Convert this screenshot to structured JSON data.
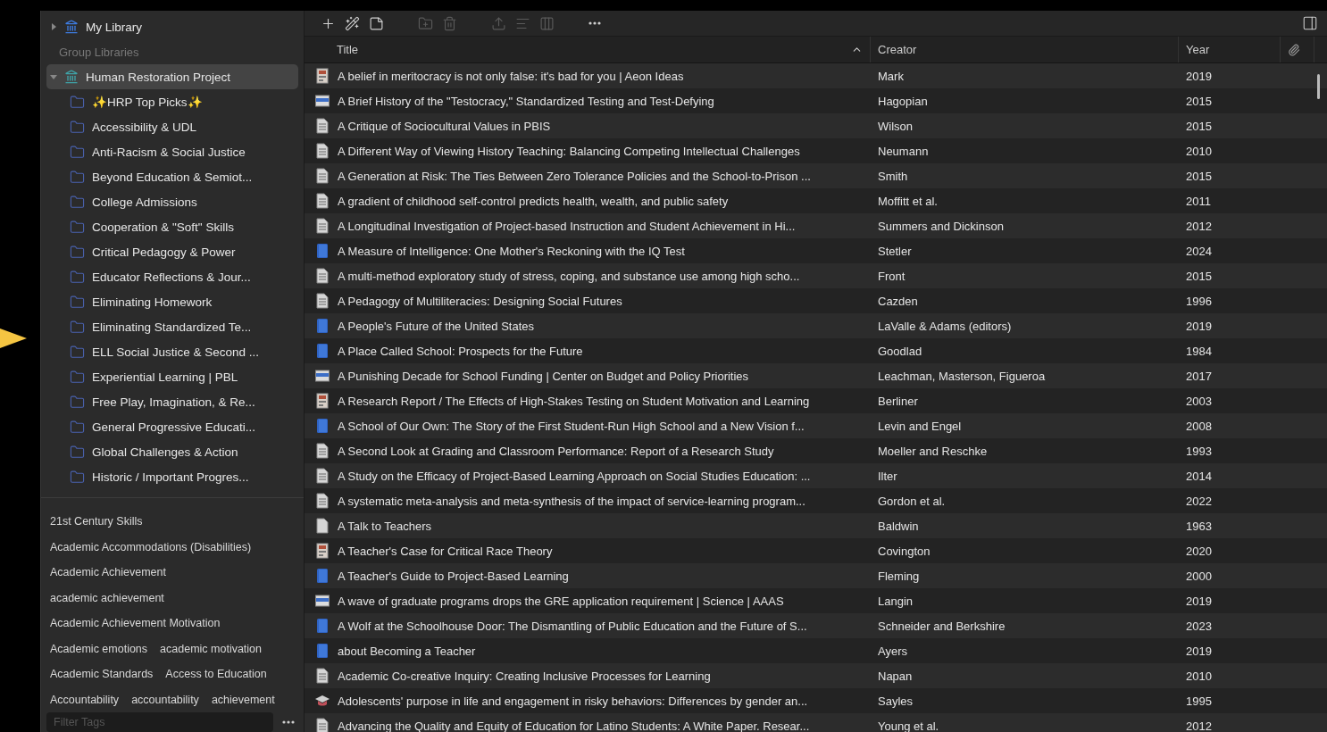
{
  "toolbar": {
    "buttons": [
      {
        "kind": "add",
        "disabled": false
      },
      {
        "kind": "wand",
        "disabled": false
      },
      {
        "kind": "note",
        "disabled": false
      },
      {
        "kind": "folder",
        "disabled": true
      },
      {
        "kind": "trash",
        "disabled": true
      },
      {
        "kind": "upload",
        "disabled": true
      },
      {
        "kind": "list",
        "disabled": true
      },
      {
        "kind": "columns",
        "disabled": true
      },
      {
        "kind": "more",
        "disabled": false
      }
    ]
  },
  "sidebar": {
    "libraries": [
      {
        "name": "My Library",
        "expanded": false,
        "selected": false
      }
    ],
    "group_header": "Group Libraries",
    "groups": [
      {
        "name": "Human Restoration Project",
        "expanded": true,
        "selected": true,
        "children": [
          {
            "name": "✨HRP Top Picks✨",
            "selected": false
          },
          {
            "name": "Accessibility & UDL",
            "selected": false
          },
          {
            "name": "Anti-Racism & Social Justice",
            "selected": false
          },
          {
            "name": "Beyond Education & Semiot...",
            "selected": false
          },
          {
            "name": "College Admissions",
            "selected": false
          },
          {
            "name": "Cooperation & \"Soft\" Skills",
            "selected": false
          },
          {
            "name": "Critical Pedagogy & Power",
            "selected": false
          },
          {
            "name": "Educator Reflections & Jour...",
            "selected": false
          },
          {
            "name": "Eliminating Homework",
            "selected": false
          },
          {
            "name": "Eliminating Standardized Te...",
            "selected": false
          },
          {
            "name": "ELL Social Justice & Second ...",
            "selected": false
          },
          {
            "name": "Experiential Learning | PBL",
            "selected": false
          },
          {
            "name": "Free Play, Imagination, & Re...",
            "selected": false
          },
          {
            "name": "General Progressive Educati...",
            "selected": false
          },
          {
            "name": "Global Challenges & Action",
            "selected": false
          },
          {
            "name": "Historic / Important Progres...",
            "selected": false
          }
        ]
      }
    ],
    "tags": [
      "21st Century Skills",
      "Academic Accommodations (Disabilities)",
      "Academic Achievement",
      "academic achievement",
      "Academic Achievement Motivation",
      "Academic emotions",
      "academic motivation",
      "Academic Standards",
      "Access to Education",
      "Accountability",
      "accountability",
      "achievement"
    ],
    "tag_filter": {
      "placeholder": "Filter Tags"
    }
  },
  "table": {
    "columns": [
      {
        "label": "Title",
        "sorted": true
      },
      {
        "label": "Creator",
        "sorted": false
      },
      {
        "label": "Year",
        "sorted": false
      }
    ],
    "rows": [
      {
        "kind": "report",
        "title": "A belief in meritocracy is not only false: it's bad for you | Aeon Ideas",
        "creator": "Mark",
        "year": "2019"
      },
      {
        "kind": "webpage",
        "title": "A Brief History of the \"Testocracy,\" Standardized Testing and Test-Defying",
        "creator": "Hagopian",
        "year": "2015"
      },
      {
        "kind": "article",
        "title": "A Critique of Sociocultural Values in PBIS",
        "creator": "Wilson",
        "year": "2015"
      },
      {
        "kind": "article",
        "title": "A Different Way of Viewing History Teaching: Balancing Competing Intellectual Challenges",
        "creator": "Neumann",
        "year": "2010"
      },
      {
        "kind": "article",
        "title": "A Generation at Risk: The Ties Between Zero Tolerance Policies and the School-to-Prison ...",
        "creator": "Smith",
        "year": "2015"
      },
      {
        "kind": "article",
        "title": "A gradient of childhood self-control predicts health, wealth, and public safety",
        "creator": "Moffitt et al.",
        "year": "2011"
      },
      {
        "kind": "article",
        "title": "A Longitudinal Investigation of Project-based Instruction and Student Achievement in Hi...",
        "creator": "Summers and Dickinson",
        "year": "2012"
      },
      {
        "kind": "book",
        "title": "A Measure of Intelligence: One Mother's Reckoning with the IQ Test",
        "creator": "Stetler",
        "year": "2024"
      },
      {
        "kind": "article",
        "title": "A multi-method exploratory study of stress, coping, and substance use among high scho...",
        "creator": "Front",
        "year": "2015"
      },
      {
        "kind": "article",
        "title": "A Pedagogy of Multiliteracies: Designing Social Futures",
        "creator": "Cazden",
        "year": "1996"
      },
      {
        "kind": "book",
        "title": "A People's Future of the United States",
        "creator": "LaValle & Adams (editors)",
        "year": "2019"
      },
      {
        "kind": "book",
        "title": "A Place Called School: Prospects for the Future",
        "creator": "Goodlad",
        "year": "1984"
      },
      {
        "kind": "webpage",
        "title": "A Punishing Decade for School Funding | Center on Budget and Policy Priorities",
        "creator": "Leachman, Masterson, Figueroa",
        "year": "2017"
      },
      {
        "kind": "report",
        "title": "A Research Report / The Effects of High-Stakes Testing on Student Motivation and Learning",
        "creator": "Berliner",
        "year": "2003"
      },
      {
        "kind": "book",
        "title": "A School of Our Own: The Story of the First Student-Run High School and a New Vision f...",
        "creator": "Levin and Engel",
        "year": "2008"
      },
      {
        "kind": "article",
        "title": "A Second Look at Grading and Classroom Performance: Report of a Research Study",
        "creator": "Moeller and Reschke",
        "year": "1993"
      },
      {
        "kind": "article",
        "title": "A Study on the Efficacy of Project-Based Learning Approach on Social Studies Education: ...",
        "creator": "Ilter",
        "year": "2014"
      },
      {
        "kind": "article",
        "title": "A systematic meta-analysis and meta-synthesis of the impact of service-learning program...",
        "creator": "Gordon et al.",
        "year": "2022"
      },
      {
        "kind": "document",
        "title": "A Talk to Teachers",
        "creator": "Baldwin",
        "year": "1963"
      },
      {
        "kind": "report",
        "title": "A Teacher's Case for Critical Race Theory",
        "creator": "Covington",
        "year": "2020"
      },
      {
        "kind": "book",
        "title": "A Teacher's Guide to Project-Based Learning",
        "creator": "Fleming",
        "year": "2000"
      },
      {
        "kind": "webpage",
        "title": "A wave of graduate programs drops the GRE application requirement | Science | AAAS",
        "creator": "Langin",
        "year": "2019"
      },
      {
        "kind": "book",
        "title": "A Wolf at the Schoolhouse Door: The Dismantling of Public Education and the Future of S...",
        "creator": "Schneider and Berkshire",
        "year": "2023"
      },
      {
        "kind": "book",
        "title": "about Becoming a Teacher",
        "creator": "Ayers",
        "year": "2019"
      },
      {
        "kind": "article",
        "title": "Academic Co-creative Inquiry: Creating Inclusive Processes for Learning",
        "creator": "Napan",
        "year": "2010"
      },
      {
        "kind": "thesis",
        "title": "Adolescents' purpose in life and engagement in risky behaviors: Differences by gender an...",
        "creator": "Sayles",
        "year": "1995"
      },
      {
        "kind": "article",
        "title": "Advancing the Quality and Equity of Education for Latino Students: A White Paper. Resear...",
        "creator": "Young et al.",
        "year": "2012"
      }
    ]
  }
}
